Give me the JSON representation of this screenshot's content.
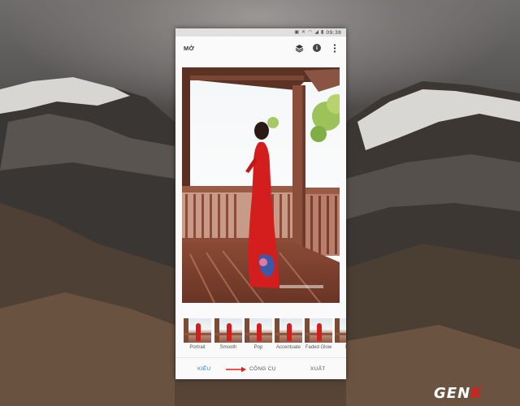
{
  "status_bar": {
    "time": "09:38"
  },
  "app_bar": {
    "open_label": "MỞ"
  },
  "filters": [
    {
      "label": "Portrait"
    },
    {
      "label": "Smooth"
    },
    {
      "label": "Pop"
    },
    {
      "label": "Accentuate"
    },
    {
      "label": "Faded Glow"
    },
    {
      "label": "Mo"
    }
  ],
  "bottom_nav": {
    "styles_label": "KIỂU",
    "tools_label": "CÔNG CỤ",
    "export_label": "XUẤT"
  },
  "watermark": {
    "brand_prefix": "GEN",
    "brand_suffix": "K"
  },
  "colors": {
    "accent": "#2e7bd6",
    "arrow": "#e21a1a",
    "dress": "#d41e1e"
  }
}
